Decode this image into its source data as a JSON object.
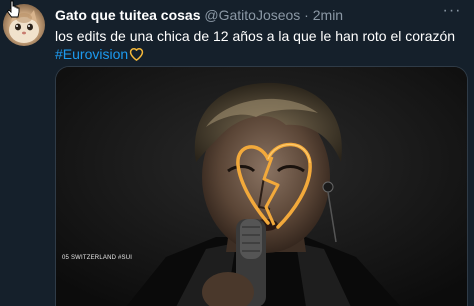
{
  "tweet": {
    "author_name": "Gato que tuitea cosas",
    "author_handle": "@GatitoJoseos",
    "separator": " · ",
    "time": "2min",
    "more_label": "···",
    "text_line1": "los edits de una chica de 12 años a la que le han roto el corazón",
    "hashtag": "#Eurovision",
    "media": {
      "caption": "05 SWITZERLAND #SUI",
      "accent_color": "#f2a93b"
    }
  },
  "colors": {
    "background": "#15202b",
    "link": "#1d9bf0",
    "secondary_text": "#8b98a5"
  },
  "icons": {
    "heart": "yellow-heart-outline-icon",
    "cursor": "pointer-cursor-icon",
    "more": "more-options-icon"
  }
}
